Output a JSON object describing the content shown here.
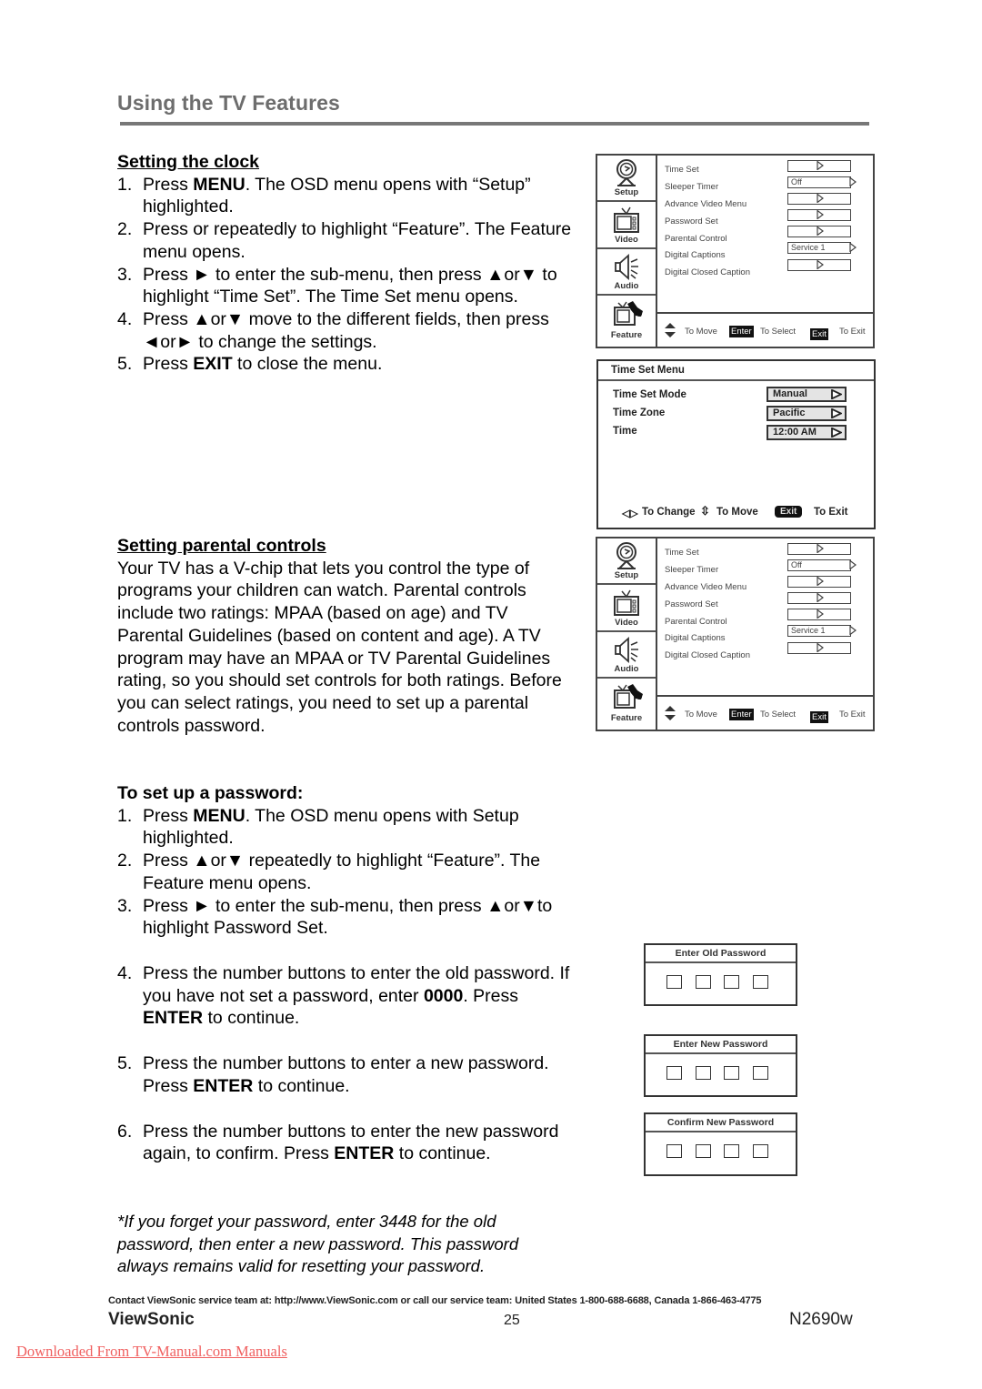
{
  "header": {
    "title": "Using the TV Features"
  },
  "clock_section": {
    "heading": "Setting the clock",
    "steps": [
      {
        "num": "1.",
        "parts": [
          {
            "t": "Press "
          },
          {
            "t": "MENU",
            "b": true
          },
          {
            "t": ". The OSD menu opens with “Setup” highlighted."
          }
        ]
      },
      {
        "num": "2.",
        "parts": [
          {
            "t": "Press or repeatedly to highlight “Feature”. The Feature menu opens."
          }
        ]
      },
      {
        "num": "3.",
        "parts": [
          {
            "t": "Press ► to enter the sub-menu, then press ▲or▼ to highlight “Time Set”. The Time Set menu opens."
          }
        ]
      },
      {
        "num": "4.",
        "parts": [
          {
            "t": "Press ▲or▼ move to the different fields, then press ◄or► to change the settings."
          }
        ]
      },
      {
        "num": "5.",
        "parts": [
          {
            "t": "Press "
          },
          {
            "t": "EXIT",
            "b": true
          },
          {
            "t": " to close the menu."
          }
        ]
      }
    ]
  },
  "parental_section": {
    "heading": "Setting parental controls",
    "intro": "Your TV has a V-chip that lets you control the type of programs your children can watch. Parental controls include two ratings: MPAA (based on age) and TV Parental Guidelines (based on content and age). A TV program may have an MPAA or TV Parental Guidelines rating, so you should set controls for both ratings. Before you can select ratings, you need to set up a parental controls password.",
    "subheading": "To set up a password:",
    "steps": [
      {
        "num": "1.",
        "parts": [
          {
            "t": "Press "
          },
          {
            "t": "MENU",
            "b": true
          },
          {
            "t": ". The OSD menu opens with Setup highlighted."
          }
        ]
      },
      {
        "num": "2.",
        "parts": [
          {
            "t": "Press ▲or▼ repeatedly to highlight “Feature”. The Feature menu opens."
          }
        ]
      },
      {
        "num": "3.",
        "parts": [
          {
            "t": "Press ► to enter the sub-menu, then press ▲or▼to highlight Password Set."
          }
        ]
      },
      {
        "num": "4.",
        "parts": [
          {
            "t": "Press the number buttons to enter the old password. If you have not set a password, enter "
          },
          {
            "t": "0000",
            "b": true
          },
          {
            "t": ". Press "
          },
          {
            "t": "ENTER",
            "b": true
          },
          {
            "t": " to continue."
          }
        ]
      },
      {
        "num": "5.",
        "parts": [
          {
            "t": "Press the number buttons to enter a new password. Press "
          },
          {
            "t": "ENTER",
            "b": true
          },
          {
            "t": " to continue."
          }
        ]
      },
      {
        "num": "6.",
        "parts": [
          {
            "t": "Press the number buttons to enter the new password again, to confirm. Press "
          },
          {
            "t": "ENTER",
            "b": true
          },
          {
            "t": " to continue."
          }
        ]
      }
    ],
    "note": "*If you forget your password, enter 3448 for the old password, then enter a new password. This password always remains valid for resetting your password."
  },
  "osd_feature_menu": {
    "tabs": [
      {
        "label": "Setup",
        "icon": "setup-icon"
      },
      {
        "label": "Video",
        "icon": "tv-icon"
      },
      {
        "label": "Audio",
        "icon": "speaker-icon"
      },
      {
        "label": "Feature",
        "icon": "feature-icon"
      }
    ],
    "items": [
      {
        "label": "Time Set",
        "value": ""
      },
      {
        "label": "Sleeper Timer",
        "value": "Off"
      },
      {
        "label": "Advance Video Menu",
        "value": ""
      },
      {
        "label": "Password Set",
        "value": ""
      },
      {
        "label": "Parental Control",
        "value": ""
      },
      {
        "label": "Digital Captions",
        "value": "Service 1"
      },
      {
        "label": "Digital Closed Caption",
        "value": ""
      }
    ],
    "footer": {
      "move": "To Move",
      "enter_key": "Enter",
      "select": "To Select",
      "exit_key": "Exit",
      "exit": "To Exit"
    }
  },
  "time_set_menu": {
    "title": "Time Set Menu",
    "rows": [
      {
        "label": "Time Set Mode",
        "value": "Manual"
      },
      {
        "label": "Time Zone",
        "value": "Pacific"
      },
      {
        "label": "Time",
        "value": "12:00 AM"
      }
    ],
    "footer": {
      "change": "To Change",
      "move": "To Move",
      "exit_key": "Exit",
      "exit": "To Exit"
    }
  },
  "password_dialogs": [
    {
      "title": "Enter Old Password"
    },
    {
      "title": "Enter New Password"
    },
    {
      "title": "Confirm New Password"
    }
  ],
  "footer": {
    "contact": "Contact ViewSonic service team at: http://www.ViewSonic.com or call our service team: United States 1-800-688-6688, Canada 1-866-463-4775",
    "brand": "ViewSonic",
    "page_number": "25",
    "model": "N2690w",
    "download_link": "Downloaded From TV-Manual.com Manuals"
  }
}
